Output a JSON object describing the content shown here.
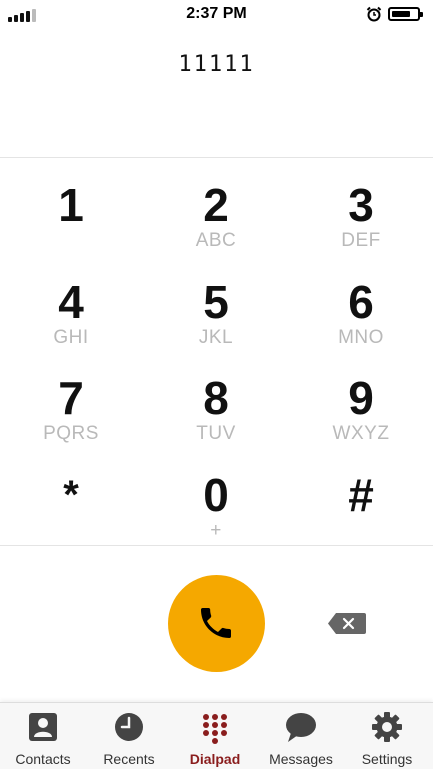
{
  "status_bar": {
    "time": "2:37 PM"
  },
  "dialed_number": "11111",
  "keypad": [
    {
      "digit": "1",
      "letters": ""
    },
    {
      "digit": "2",
      "letters": "ABC"
    },
    {
      "digit": "3",
      "letters": "DEF"
    },
    {
      "digit": "4",
      "letters": "GHI"
    },
    {
      "digit": "5",
      "letters": "JKL"
    },
    {
      "digit": "6",
      "letters": "MNO"
    },
    {
      "digit": "7",
      "letters": "PQRS"
    },
    {
      "digit": "8",
      "letters": "TUV"
    },
    {
      "digit": "9",
      "letters": "WXYZ"
    },
    {
      "digit": "*",
      "letters": ""
    },
    {
      "digit": "0",
      "letters": "+"
    },
    {
      "digit": "#",
      "letters": ""
    }
  ],
  "colors": {
    "call_button": "#f5a800",
    "active_tab": "#8a1d1d",
    "sub_letters": "#b9b9b9"
  },
  "tabs": [
    {
      "label": "Contacts",
      "icon": "contacts-icon"
    },
    {
      "label": "Recents",
      "icon": "clock-icon"
    },
    {
      "label": "Dialpad",
      "icon": "dialpad-icon",
      "active": true
    },
    {
      "label": "Messages",
      "icon": "chat-bubble-icon"
    },
    {
      "label": "Settings",
      "icon": "gear-icon"
    }
  ]
}
